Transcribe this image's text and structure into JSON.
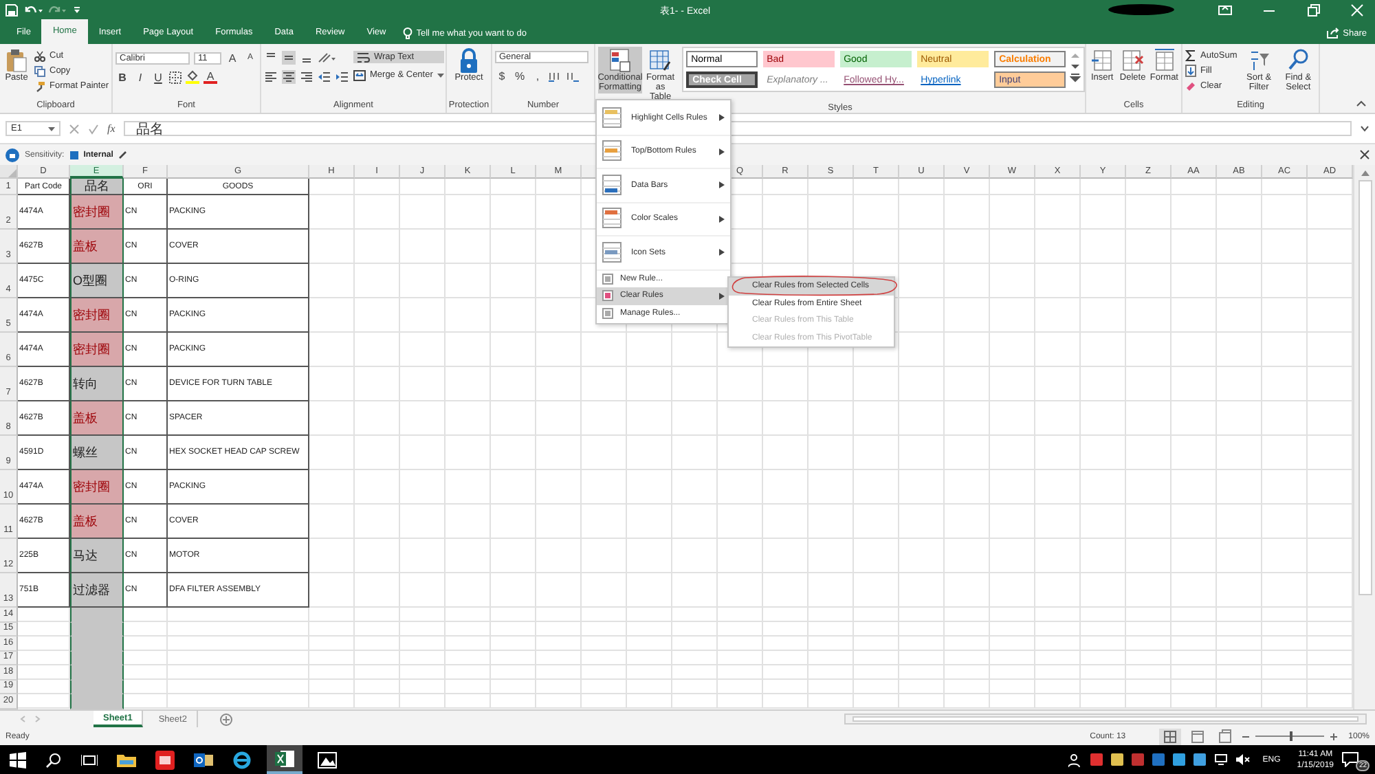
{
  "title_bar": {
    "title": "表1-  - Excel"
  },
  "tabs": [
    {
      "label": "File",
      "selected": false
    },
    {
      "label": "Home",
      "selected": true
    },
    {
      "label": "Insert",
      "selected": false
    },
    {
      "label": "Page Layout",
      "selected": false
    },
    {
      "label": "Formulas",
      "selected": false
    },
    {
      "label": "Data",
      "selected": false
    },
    {
      "label": "Review",
      "selected": false
    },
    {
      "label": "View",
      "selected": false
    }
  ],
  "tell_me": {
    "placeholder": "Tell me what you want to do"
  },
  "share": "Share",
  "ribbon": {
    "clipboard": {
      "label": "Clipboard",
      "paste": "Paste",
      "cut": "Cut",
      "copy": "Copy",
      "format_painter": "Format Painter"
    },
    "font": {
      "label": "Font",
      "font_name": "Calibri",
      "font_size": "11",
      "grow": "A",
      "shrink": "A",
      "bold": "B",
      "italic": "I",
      "underline": "U",
      "font_color": "A"
    },
    "alignment": {
      "label": "Alignment",
      "wrap_text": "Wrap Text",
      "wrap_on": true,
      "merge_center": "Merge & Center"
    },
    "protection": {
      "label": "Protection",
      "protect": "Protect"
    },
    "number": {
      "label": "Number",
      "format": "General",
      "currency": "$",
      "percent": "%",
      "comma": ","
    },
    "styles": {
      "label": "Styles",
      "conditional_formatting": "Conditional Formatting",
      "conditional_open": true,
      "format_as_table": "Format as Table",
      "cell_styles": [
        {
          "label": "Normal",
          "kind": "normal"
        },
        {
          "label": "Bad",
          "kind": "bad"
        },
        {
          "label": "Good",
          "kind": "good"
        },
        {
          "label": "Neutral",
          "kind": "neutral"
        },
        {
          "label": "Calculation",
          "kind": "calculation"
        },
        {
          "label": "Check Cell",
          "kind": "check"
        },
        {
          "label": "Explanatory ...",
          "kind": "explanatory"
        },
        {
          "label": "Followed Hy...",
          "kind": "followed"
        },
        {
          "label": "Hyperlink",
          "kind": "hyperlink"
        },
        {
          "label": "Input",
          "kind": "input"
        }
      ]
    },
    "cells": {
      "label": "Cells",
      "insert": "Insert",
      "delete": "Delete",
      "format": "Format"
    },
    "editing": {
      "label": "Editing",
      "autosum": "AutoSum",
      "fill": "Fill",
      "clear": "Clear",
      "sort_filter": "Sort & Filter",
      "find_select": "Find & Select"
    }
  },
  "formula_bar": {
    "name_box": "E1",
    "fx": "fx",
    "value": "品名"
  },
  "sensitivity": {
    "label": "Sensitivity:",
    "value": "Internal"
  },
  "sheet": {
    "columns": [
      {
        "label": "D",
        "selected": false
      },
      {
        "label": "E",
        "selected": true
      },
      {
        "label": "F",
        "selected": false
      },
      {
        "label": "G",
        "selected": false
      },
      {
        "label": "H",
        "selected": false
      },
      {
        "label": "I",
        "selected": false
      },
      {
        "label": "J",
        "selected": false
      },
      {
        "label": "K",
        "selected": false
      },
      {
        "label": "L",
        "selected": false
      },
      {
        "label": "M",
        "selected": false
      }
    ],
    "columns_right": [
      {
        "label": "Q",
        "selected": false
      },
      {
        "label": "R",
        "selected": false
      },
      {
        "label": "S",
        "selected": false
      },
      {
        "label": "T",
        "selected": false
      },
      {
        "label": "U",
        "selected": false
      },
      {
        "label": "V",
        "selected": false
      },
      {
        "label": "W",
        "selected": false
      },
      {
        "label": "X",
        "selected": false
      },
      {
        "label": "Y",
        "selected": false
      },
      {
        "label": "Z",
        "selected": false
      },
      {
        "label": "AA",
        "selected": false
      },
      {
        "label": "AB",
        "selected": false
      },
      {
        "label": "AC",
        "selected": false
      },
      {
        "label": "AD",
        "selected": false
      }
    ],
    "rows": [
      {
        "number": "1",
        "header": true,
        "cells": [
          "Part Code",
          "品名",
          "ORI",
          "GOODS"
        ]
      },
      {
        "number": "2",
        "highlight": true,
        "cells": [
          "4474A",
          "密封圈",
          "CN",
          "PACKING"
        ]
      },
      {
        "number": "3",
        "highlight": true,
        "cells": [
          "4627B",
          "盖板",
          "CN",
          "COVER"
        ]
      },
      {
        "number": "4",
        "highlight": false,
        "cells": [
          "4475C",
          "O型圈",
          "CN",
          "O-RING"
        ]
      },
      {
        "number": "5",
        "highlight": true,
        "cells": [
          "4474A",
          "密封圈",
          "CN",
          "PACKING"
        ]
      },
      {
        "number": "6",
        "highlight": true,
        "cells": [
          "4474A",
          "密封圈",
          "CN",
          "PACKING"
        ]
      },
      {
        "number": "7",
        "highlight": false,
        "cells": [
          "4627B",
          "转向",
          "CN",
          "DEVICE FOR TURN TABLE"
        ]
      },
      {
        "number": "8",
        "highlight": true,
        "cells": [
          "4627B",
          "盖板",
          "CN",
          "SPACER"
        ]
      },
      {
        "number": "9",
        "highlight": false,
        "cells": [
          "4591D",
          "螺丝",
          "CN",
          "HEX SOCKET HEAD CAP SCREW"
        ]
      },
      {
        "number": "10",
        "highlight": true,
        "cells": [
          "4474A",
          "密封圈",
          "CN",
          "PACKING"
        ]
      },
      {
        "number": "11",
        "highlight": true,
        "cells": [
          "4627B",
          "盖板",
          "CN",
          "COVER"
        ]
      },
      {
        "number": "12",
        "highlight": false,
        "cells": [
          "225B",
          "马达",
          "CN",
          "MOTOR"
        ]
      },
      {
        "number": "13",
        "highlight": false,
        "cells": [
          "751B",
          "过滤器",
          "CN",
          "DFA FILTER ASSEMBLY"
        ]
      },
      {
        "number": "14"
      },
      {
        "number": "15"
      },
      {
        "number": "16"
      },
      {
        "number": "17"
      },
      {
        "number": "18"
      },
      {
        "number": "19"
      },
      {
        "number": "20"
      }
    ]
  },
  "cf_menu": {
    "items": [
      {
        "label": "Highlight Cells Rules",
        "kind": "large",
        "submenu": true,
        "selected": false
      },
      {
        "label": "Top/Bottom Rules",
        "kind": "large",
        "submenu": true,
        "selected": false
      },
      {
        "label": "Data Bars",
        "kind": "large",
        "submenu": true,
        "selected": false
      },
      {
        "label": "Color Scales",
        "kind": "large",
        "submenu": true,
        "selected": false
      },
      {
        "label": "Icon Sets",
        "kind": "large",
        "submenu": true,
        "selected": false
      },
      {
        "label": "New Rule...",
        "kind": "small",
        "submenu": false,
        "selected": false
      },
      {
        "label": "Clear Rules",
        "kind": "small",
        "submenu": true,
        "selected": true
      },
      {
        "label": "Manage Rules...",
        "kind": "small",
        "submenu": false,
        "selected": false
      }
    ],
    "submenu": [
      {
        "label": "Clear Rules from Selected Cells",
        "selected": true,
        "disabled": false,
        "circled": true
      },
      {
        "label": "Clear Rules from Entire Sheet",
        "selected": false,
        "disabled": false,
        "circled": false
      },
      {
        "label": "Clear Rules from This Table",
        "selected": false,
        "disabled": true,
        "circled": false
      },
      {
        "label": "Clear Rules from This PivotTable",
        "selected": false,
        "disabled": true,
        "circled": false
      }
    ]
  },
  "sheet_tabs": [
    {
      "label": "Sheet1",
      "selected": true
    },
    {
      "label": "Sheet2",
      "selected": false
    }
  ],
  "status_bar": {
    "status": "Ready",
    "count": "Count: 13",
    "zoom": "100%",
    "zoom_slider": {
      "level": 0.5
    }
  },
  "taskbar": {
    "language": "ENG",
    "time": "11:41 AM",
    "date": "1/15/2019",
    "notifications": "22"
  }
}
